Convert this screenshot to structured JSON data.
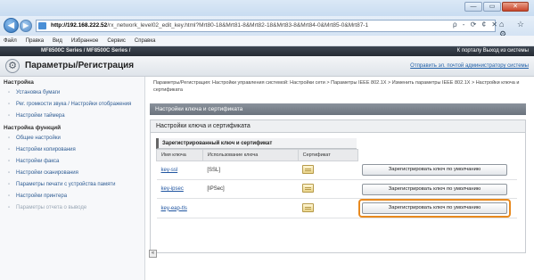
{
  "browser": {
    "url_host": "http://192.168.222.52",
    "url_path": "/rx_network_level02_edit_key.html?Mrt80-18&Mrt81-8&Mrt82-18&Mrt83-8&Mrt84-0&Mrt85-0&Mrt87-1",
    "url_tools": "ρ - ⟳ ¢ ✕",
    "tab_icons": "⌂ ☆ ⚙",
    "menu": [
      "Файл",
      "Правка",
      "Вид",
      "Избранное",
      "Сервис",
      "Справка"
    ],
    "window_buttons": [
      "—",
      "▭",
      "✕"
    ]
  },
  "device": {
    "name": "MF8500C Series / MF8500C Series /",
    "top_links": "К порталу  Выход из системы"
  },
  "header": {
    "title": "Параметры/Регистрация",
    "admin_link": "Отправить эл. почтой администратору системы"
  },
  "sidebar": {
    "section1": "Настройка",
    "group1": [
      "Установка бумаги",
      "Рег. громкости звука / Настройки отображения",
      "Настройки таймера"
    ],
    "section2": "Настройка функций",
    "group2": [
      "Общие настройки",
      "Настройки копирования",
      "Настройки факса",
      "Настройки сканирования",
      "Параметры печати с устройства памяти",
      "Настройки принтера",
      "Параметры отчета о выводе"
    ]
  },
  "main": {
    "breadcrumb": "Параметры/Регистрация: Настройки управления системой: Настройки сети > Параметры IEEE 802.1X > Изменить параметры IEEE 802.1X > Настройки ключа и сертификата",
    "section_bar": "Настройки ключа и сертификата",
    "panel_title": "Настройки ключа и сертификата",
    "table_caption": "Зарегистрированный ключ и сертификат",
    "columns": [
      "Имя ключа",
      "Использование ключа",
      "Сертификат"
    ],
    "rows": [
      {
        "key": "key-ssl",
        "usage": "[SSL]",
        "button": "Зарегистрировать ключ по умолчанию"
      },
      {
        "key": "key-ipsec",
        "usage": "[IPSec]",
        "button": "Зарегистрировать ключ по умолчанию"
      },
      {
        "key": "key-eap-tls",
        "usage": "",
        "button": "Зарегистрировать ключ по умолчанию"
      }
    ],
    "back_glyph": "«"
  },
  "colors": {
    "highlight": "#e8891e",
    "link": "#2055a0",
    "device_bar": "#2f3640"
  }
}
